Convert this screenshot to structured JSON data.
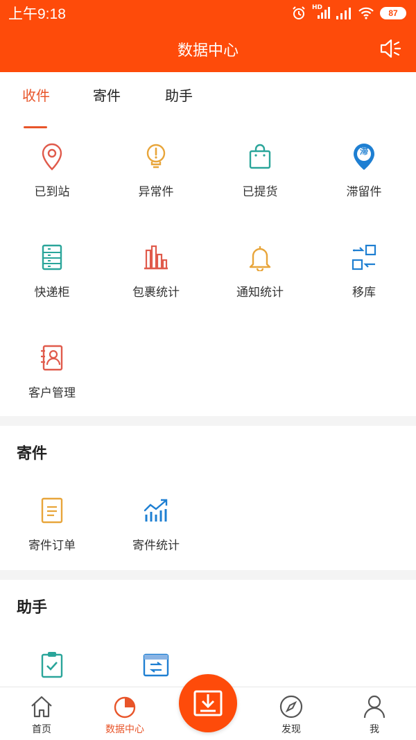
{
  "status_bar": {
    "time": "上午9:18",
    "hd_label": "HD",
    "battery": "87"
  },
  "header": {
    "title": "数据中心"
  },
  "tabs": [
    {
      "label": "收件",
      "active": true
    },
    {
      "label": "寄件",
      "active": false
    },
    {
      "label": "助手",
      "active": false
    }
  ],
  "receive": {
    "items": [
      {
        "label": "已到站",
        "icon": "location-pin-icon"
      },
      {
        "label": "异常件",
        "icon": "warning-bulb-icon"
      },
      {
        "label": "已提货",
        "icon": "shopping-bag-icon"
      },
      {
        "label": "滞留件",
        "icon": "retained-pin-icon",
        "badge": "滞"
      },
      {
        "label": "快递柜",
        "icon": "locker-icon"
      },
      {
        "label": "包裹统计",
        "icon": "bar-chart-icon"
      },
      {
        "label": "通知统计",
        "icon": "bell-icon"
      },
      {
        "label": "移库",
        "icon": "transfer-icon"
      },
      {
        "label": "客户管理",
        "icon": "customer-card-icon"
      }
    ]
  },
  "send": {
    "heading": "寄件",
    "items": [
      {
        "label": "寄件订单",
        "icon": "order-doc-icon"
      },
      {
        "label": "寄件统计",
        "icon": "trend-chart-icon"
      }
    ]
  },
  "helper": {
    "heading": "助手",
    "items": [
      {
        "icon": "clipboard-check-icon"
      },
      {
        "icon": "box-exchange-icon"
      }
    ]
  },
  "bottom_nav": [
    {
      "label": "首页",
      "icon": "home-icon",
      "active": false
    },
    {
      "label": "数据中心",
      "icon": "pie-chart-icon",
      "active": true
    },
    {
      "label": "",
      "icon": "download-icon",
      "active": false
    },
    {
      "label": "发现",
      "icon": "compass-icon",
      "active": false
    },
    {
      "label": "我",
      "icon": "user-icon",
      "active": false
    }
  ],
  "colors": {
    "brand": "#fe4b0a",
    "accent_text": "#e8552a",
    "teal": "#2aa59a",
    "blue": "#1e7fd2",
    "gold": "#e8a53a",
    "red": "#e05a4b"
  }
}
